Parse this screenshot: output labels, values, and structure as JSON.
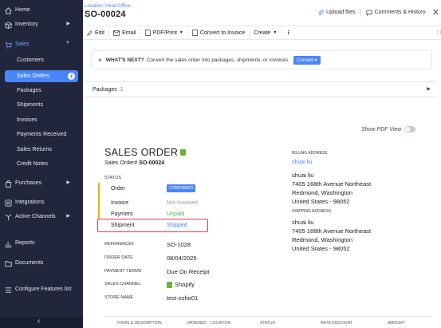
{
  "sidebar": {
    "home": "Home",
    "inventory": "Inventory",
    "sales": "Sales",
    "customers": "Customers",
    "sales_orders": "Sales Orders",
    "packages": "Packages",
    "shipments": "Shipments",
    "invoices": "Invoices",
    "payments_received": "Payments Received",
    "sales_returns": "Sales Returns",
    "credit_notes": "Credit Notes",
    "purchases": "Purchases",
    "integrations": "Integrations",
    "active_channels": "Active Channels",
    "reports": "Reports",
    "documents": "Documents",
    "configure": "Configure Features list"
  },
  "header": {
    "location": "Location: Head Office",
    "title": "SO-00024",
    "upload_files": "Upload files",
    "comments_history": "Comments & History"
  },
  "toolbar": {
    "edit": "Edit",
    "email": "Email",
    "pdf_print": "PDF/Print",
    "convert_invoice": "Convert to Invoice",
    "create": "Create",
    "more": "⋮"
  },
  "whats_next": {
    "label": "WHAT'S NEXT?",
    "text": "Convert the sales order into packages, shipments, or invoices.",
    "button": "Convert"
  },
  "packages": {
    "label": "Packages",
    "count": "1"
  },
  "pdf_view_label": "Show PDF View",
  "document": {
    "title": "SALES ORDER",
    "order_label": "Sales Order#",
    "order_number": "SO-00024",
    "status_heading": "STATUS",
    "order_status_label": "Order",
    "order_status": "CONFIRMED",
    "invoice_label": "Invoice",
    "invoice_status": "Not Invoiced",
    "payment_label": "Payment",
    "payment_status": "Unpaid",
    "shipment_label": "Shipment",
    "shipment_status": "Shipped",
    "reference_label": "REFERENCE#",
    "reference": "SO-1028",
    "order_date_label": "ORDER DATE",
    "order_date": "08/04/2025",
    "payment_terms_label": "PAYMENT TERMS",
    "payment_terms": "Due On Receipt",
    "sales_channel_label": "SALES CHANNEL",
    "sales_channel": "Shopify",
    "store_name_label": "STORE NAME",
    "store_name": "test-zoho01"
  },
  "billing": {
    "heading": "BILLING ADDRESS",
    "customer_link": "shuai liu",
    "name": "shuai liu",
    "line1": "7405 168th Avenue Northeast",
    "line2": "Redmond, Washington",
    "line3": "United States - 98052"
  },
  "shipping": {
    "heading": "SHIPPING ADDRESS",
    "name": "shuai liu",
    "line1": "7405 168th Avenue Northeast",
    "line2": "Redmond, Washington",
    "line3": "United States - 98052"
  },
  "items_table": {
    "columns": [
      "ITEMS & DESCRIPTION",
      "ORDERED",
      "LOCATION",
      "STATUS",
      "RATE",
      "DISCOUNT",
      "AMOUNT"
    ]
  },
  "colors": {
    "sidebar_bg": "#21263c",
    "accent": "#4a86f7",
    "status_bar": "#f2b200",
    "highlight": "#e23c4a"
  }
}
